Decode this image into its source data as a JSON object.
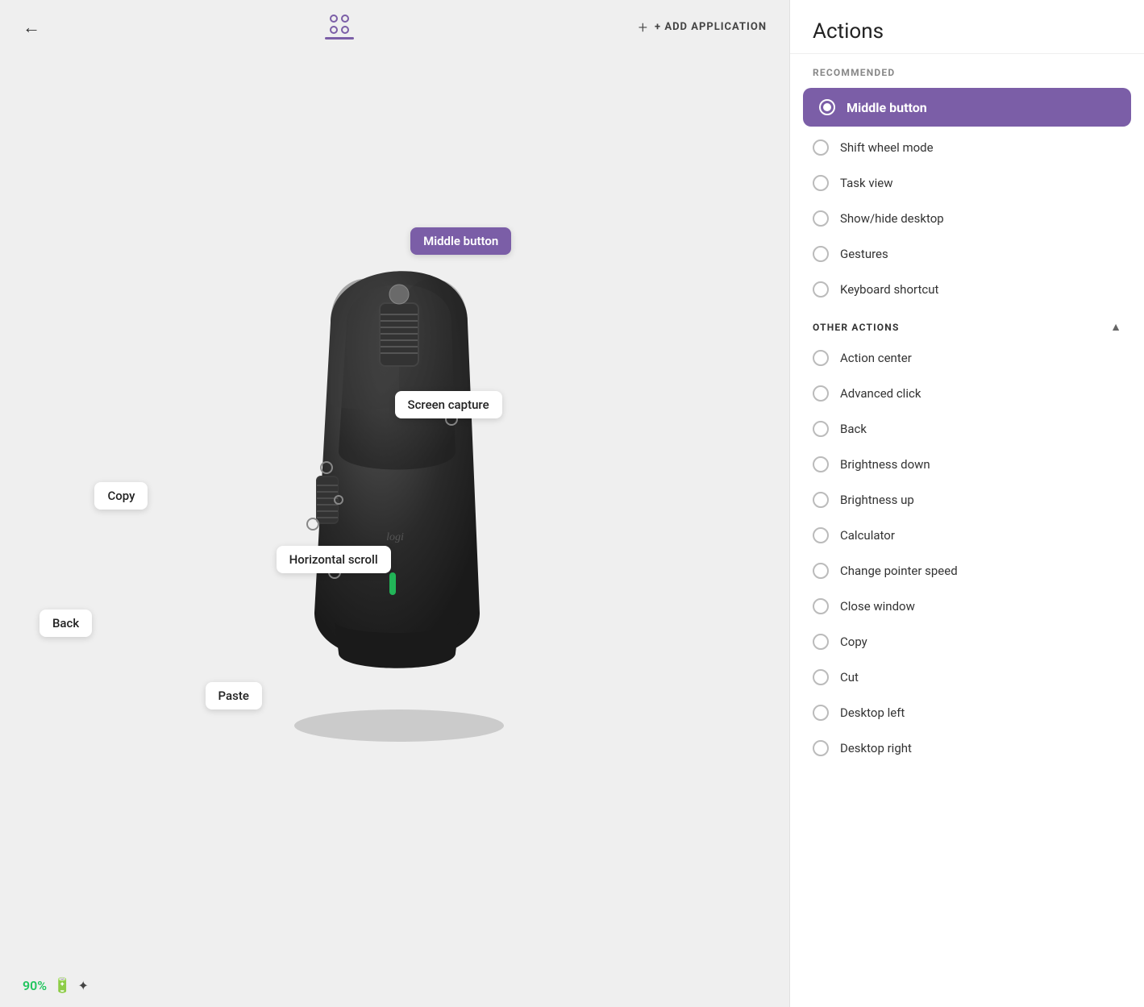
{
  "header": {
    "back_label": "←",
    "add_app_label": "+ ADD APPLICATION"
  },
  "mouse": {
    "labels": [
      {
        "id": "middle-button",
        "text": "Middle button",
        "style": "purple"
      },
      {
        "id": "screen-capture",
        "text": "Screen capture",
        "style": "normal"
      },
      {
        "id": "copy",
        "text": "Copy",
        "style": "normal"
      },
      {
        "id": "horizontal-scroll",
        "text": "Horizontal scroll",
        "style": "normal"
      },
      {
        "id": "back",
        "text": "Back",
        "style": "normal"
      },
      {
        "id": "paste",
        "text": "Paste",
        "style": "normal"
      }
    ]
  },
  "status": {
    "battery_pct": "90%",
    "battery_icon": "🔋",
    "bluetooth_icon": "✦"
  },
  "actions": {
    "panel_title": "Actions",
    "recommended_label": "RECOMMENDED",
    "recommended_items": [
      {
        "id": "middle-button",
        "label": "Middle button",
        "selected": true
      },
      {
        "id": "shift-wheel",
        "label": "Shift wheel mode",
        "selected": false
      },
      {
        "id": "task-view",
        "label": "Task view",
        "selected": false
      },
      {
        "id": "show-hide-desktop",
        "label": "Show/hide desktop",
        "selected": false
      },
      {
        "id": "gestures",
        "label": "Gestures",
        "selected": false
      },
      {
        "id": "keyboard-shortcut",
        "label": "Keyboard shortcut",
        "selected": false
      }
    ],
    "other_actions_label": "OTHER ACTIONS",
    "other_actions_items": [
      {
        "id": "action-center",
        "label": "Action center"
      },
      {
        "id": "advanced-click",
        "label": "Advanced click"
      },
      {
        "id": "back",
        "label": "Back"
      },
      {
        "id": "brightness-down",
        "label": "Brightness down"
      },
      {
        "id": "brightness-up",
        "label": "Brightness up"
      },
      {
        "id": "calculator",
        "label": "Calculator"
      },
      {
        "id": "change-pointer-speed",
        "label": "Change pointer speed"
      },
      {
        "id": "close-window",
        "label": "Close window"
      },
      {
        "id": "copy",
        "label": "Copy"
      },
      {
        "id": "cut",
        "label": "Cut"
      },
      {
        "id": "desktop-left",
        "label": "Desktop left"
      },
      {
        "id": "desktop-right",
        "label": "Desktop right"
      }
    ]
  }
}
